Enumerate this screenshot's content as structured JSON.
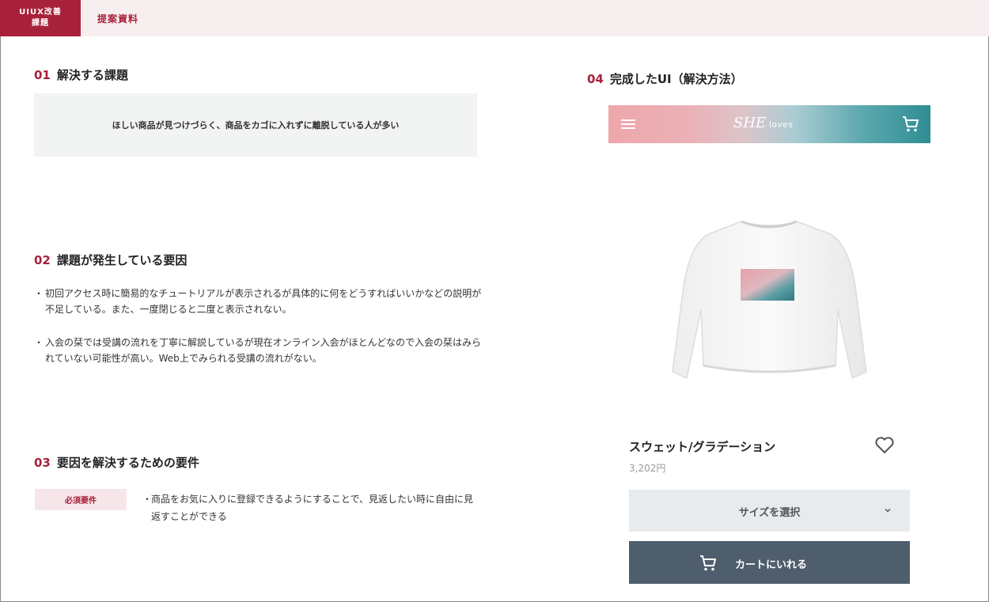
{
  "header": {
    "badge_line1": "UIUX改善",
    "badge_line2": "課題",
    "doc_title": "提案資料"
  },
  "sections": {
    "s1": {
      "num": "01",
      "title": "解決する課題",
      "box_text": "ほしい商品が見つけづらく、商品をカゴに入れずに離脱している人が多い"
    },
    "s2": {
      "num": "02",
      "title": "課題が発生している要因",
      "items": [
        {
          "bullet": "・",
          "text": "初回アクセス時に簡易的なチュートリアルが表示されるが具体的に何をどうすればいいかなどの説明が不足している。また、一度閉じると二度と表示されない。"
        },
        {
          "bullet": "・",
          "text": "入会の栞では受講の流れを丁寧に解説しているが現在オンライン入会がほとんどなので入会の栞はみられていない可能性が高い。Web上でみられる受講の流れがない。"
        }
      ]
    },
    "s3": {
      "num": "03",
      "title": "要因を解決するための要件",
      "tag": "必須要件",
      "bullet": "・",
      "text": "商品をお気に入りに登録できるようにすることで、見返したい時に自由に見返すことができる"
    },
    "s4": {
      "num": "04",
      "title": "完成したUI（解決方法）"
    }
  },
  "mockup": {
    "logo_script": "SHE",
    "logo_word": "loves",
    "product_name": "スウェット/グラデーション",
    "price": "3,202円",
    "size_button": "サイズを選択",
    "cart_button": "カートにいれる",
    "icons": [
      "hamburger-icon",
      "cart-icon",
      "heart-icon",
      "chevron-down-icon"
    ],
    "colors": {
      "accent": "#a8213a",
      "cart_button": "#4f5e6d",
      "size_button": "#e8ebee"
    }
  }
}
